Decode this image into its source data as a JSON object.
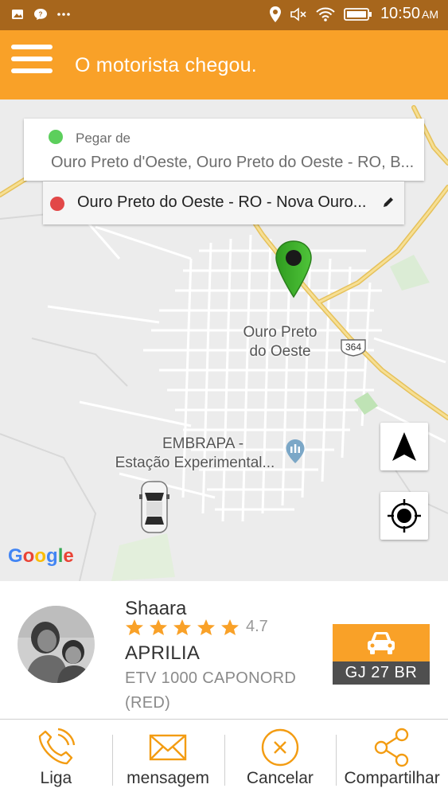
{
  "status_bar": {
    "time": "10:50",
    "ampm": "AM",
    "left_icons": [
      "image-icon",
      "chat-icon",
      "more-dots"
    ],
    "right_icons": [
      "location-icon",
      "mute-icon",
      "wifi-icon",
      "battery-icon"
    ]
  },
  "app_bar": {
    "title": "O motorista chegou.",
    "menu_icon": "hamburger-menu-icon",
    "color": "#f9a128"
  },
  "pickup": {
    "label": "Pegar de",
    "address": "Ouro Preto d'Oeste, Ouro Preto do Oeste - RO, B...",
    "dot_color": "#5ccf5c"
  },
  "dropoff": {
    "address": "Ouro Preto do Oeste - RO - Nova Ouro...",
    "dot_color": "#e24848",
    "edit_icon": "pencil-icon"
  },
  "map": {
    "city_label_1": "Ouro Preto",
    "city_label_2": "do Oeste",
    "poi_label_1": "EMBRAPA -",
    "poi_label_2": "Estação Experimental...",
    "road_number": "364",
    "google": [
      "G",
      "o",
      "o",
      "g",
      "l",
      "e"
    ]
  },
  "driver": {
    "name": "Shaara",
    "rating": "4.7",
    "stars": 5,
    "vehicle": "APRILIA",
    "model": "ETV 1000 CAPONORD",
    "color": "(RED)",
    "plate": "GJ 27 BR"
  },
  "actions": {
    "call": "Liga",
    "message": "mensagem",
    "cancel": "Cancelar",
    "share": "Compartilhar",
    "icon_color": "#f39c12"
  }
}
